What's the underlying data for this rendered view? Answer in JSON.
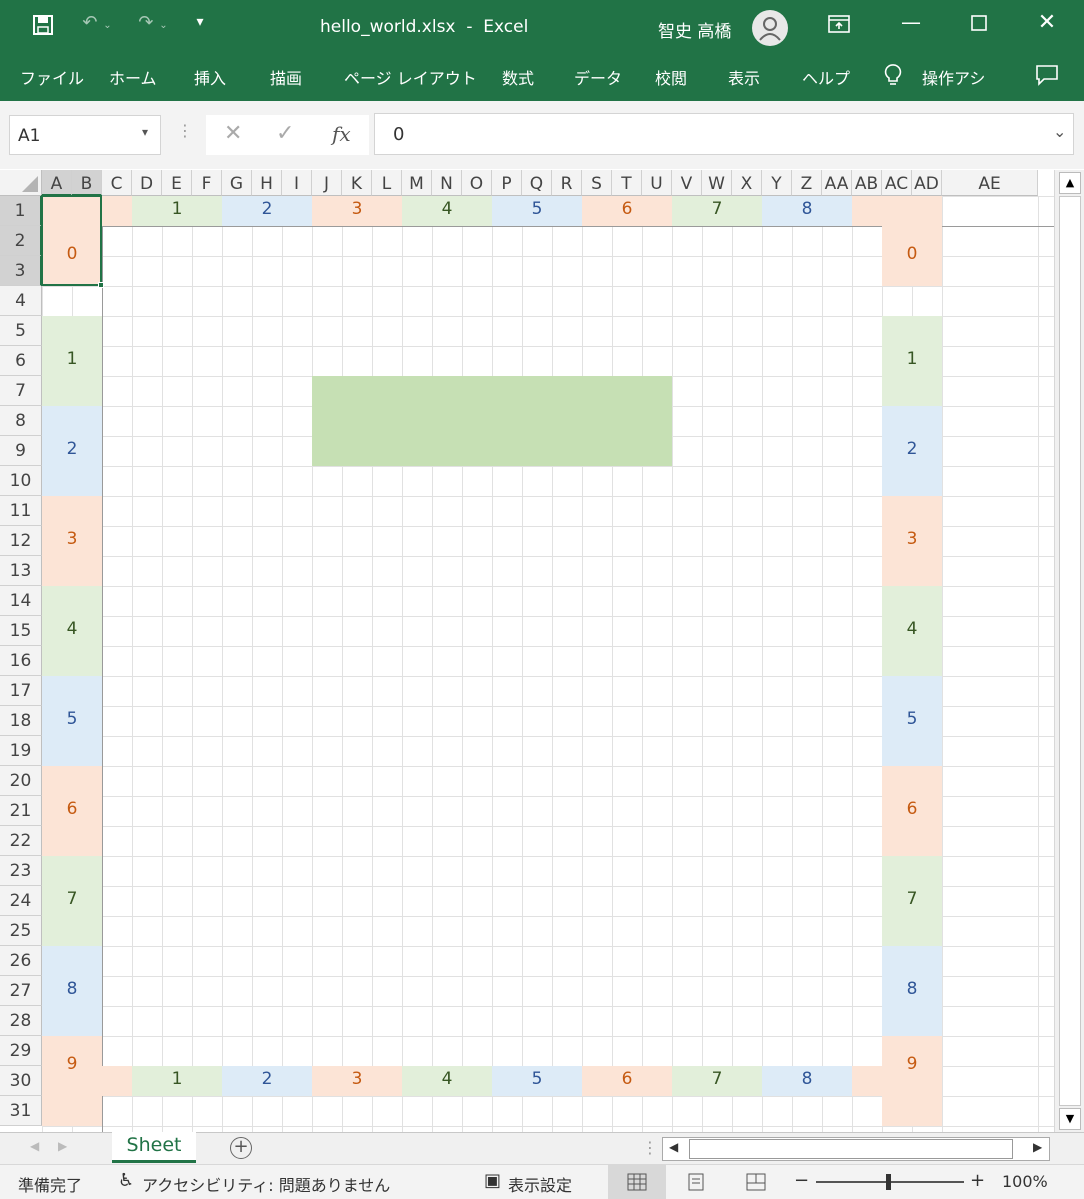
{
  "window": {
    "file_name": "hello_world.xlsx",
    "separator": "-",
    "app_name": "Excel",
    "user_name": "智史 高橋"
  },
  "menu": [
    "ファイル",
    "ホーム",
    "挿入",
    "描画",
    "ページ レイアウト",
    "数式",
    "データ",
    "校閲",
    "表示",
    "ヘルプ"
  ],
  "tell_me": "操作アシ",
  "formula_bar": {
    "name_box": "A1",
    "formula_value": "0",
    "fx_label": "fx"
  },
  "columns": [
    "A",
    "B",
    "C",
    "D",
    "E",
    "F",
    "G",
    "H",
    "I",
    "J",
    "K",
    "L",
    "M",
    "N",
    "O",
    "P",
    "Q",
    "R",
    "S",
    "T",
    "U",
    "V",
    "W",
    "X",
    "Y",
    "Z",
    "AA",
    "AB",
    "AC",
    "AD",
    "AE"
  ],
  "rows": [
    "1",
    "2",
    "3",
    "4",
    "5",
    "6",
    "7",
    "8",
    "9",
    "10",
    "11",
    "12",
    "13",
    "14",
    "15",
    "16",
    "17",
    "18",
    "19",
    "20",
    "21",
    "22",
    "23",
    "24",
    "25",
    "26",
    "27",
    "28",
    "29",
    "30",
    "31"
  ],
  "horizontal_labels": [
    "1",
    "2",
    "3",
    "4",
    "5",
    "6",
    "7",
    "8"
  ],
  "vertical_labels": [
    "0",
    "1",
    "2",
    "3",
    "4",
    "5",
    "6",
    "7",
    "8",
    "9"
  ],
  "colors": {
    "orange": "#fce4d6",
    "green": "#e2efda",
    "blue": "#ddebf7",
    "center_green": "#c6e0b4",
    "excel_green": "#217346",
    "text_orange": "#c55a11",
    "text_green": "#375623",
    "text_blue": "#2f5597"
  },
  "sheet_tab": "Sheet",
  "status": {
    "ready": "準備完了",
    "accessibility": "アクセシビリティ: 問題ありません",
    "display_settings": "表示設定",
    "zoom": "100%"
  }
}
